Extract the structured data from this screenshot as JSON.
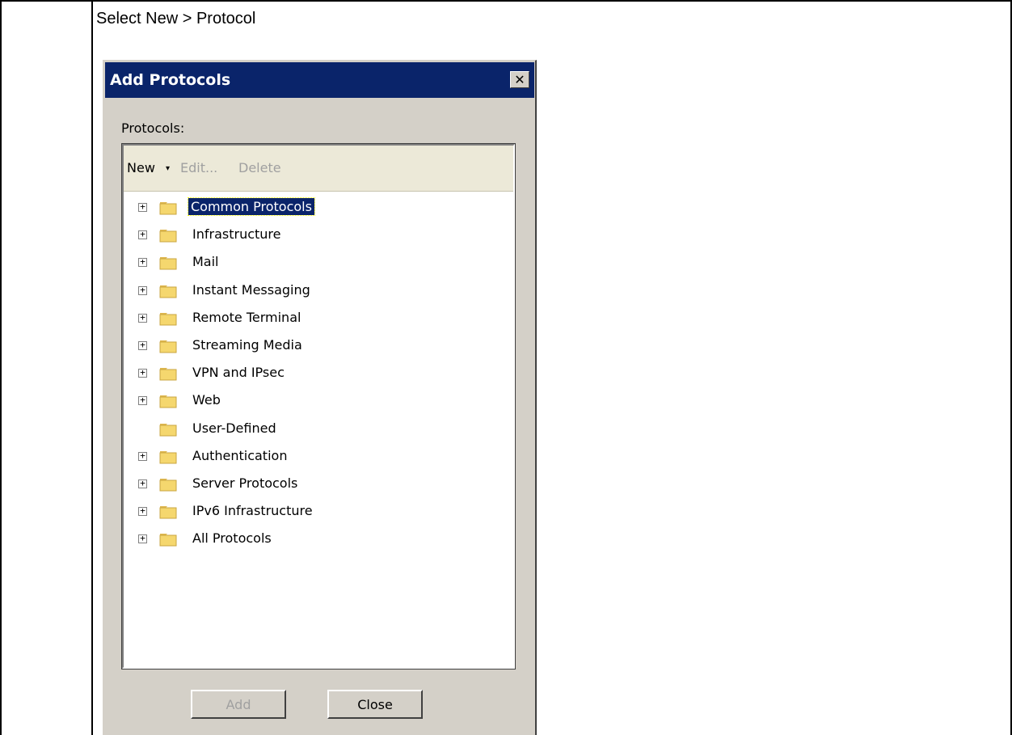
{
  "instruction": "Select New > Protocol",
  "dialog": {
    "title": "Add Protocols",
    "close_glyph": "✕",
    "protocols_label": "Protocols:",
    "toolbar": {
      "new_label": "New",
      "new_arrow": "▾",
      "edit_label": "Edit...",
      "delete_label": "Delete"
    },
    "tree": [
      {
        "label": "Common Protocols",
        "expandable": true,
        "selected": true
      },
      {
        "label": "Infrastructure",
        "expandable": true,
        "selected": false
      },
      {
        "label": "Mail",
        "expandable": true,
        "selected": false
      },
      {
        "label": "Instant Messaging",
        "expandable": true,
        "selected": false
      },
      {
        "label": "Remote Terminal",
        "expandable": true,
        "selected": false
      },
      {
        "label": "Streaming Media",
        "expandable": true,
        "selected": false
      },
      {
        "label": "VPN and IPsec",
        "expandable": true,
        "selected": false
      },
      {
        "label": "Web",
        "expandable": true,
        "selected": false
      },
      {
        "label": "User-Defined",
        "expandable": false,
        "selected": false
      },
      {
        "label": "Authentication",
        "expandable": true,
        "selected": false
      },
      {
        "label": "Server Protocols",
        "expandable": true,
        "selected": false
      },
      {
        "label": "IPv6 Infrastructure",
        "expandable": true,
        "selected": false
      },
      {
        "label": "All Protocols",
        "expandable": true,
        "selected": false
      }
    ],
    "add_button": "Add",
    "close_button": "Close"
  },
  "colors": {
    "titlebar": "#0a246a",
    "dialog_bg": "#d4d0c8",
    "toolbar_bg": "#ece9d8",
    "folder": "#f5d76e",
    "disabled_text": "#a0a0a0"
  }
}
